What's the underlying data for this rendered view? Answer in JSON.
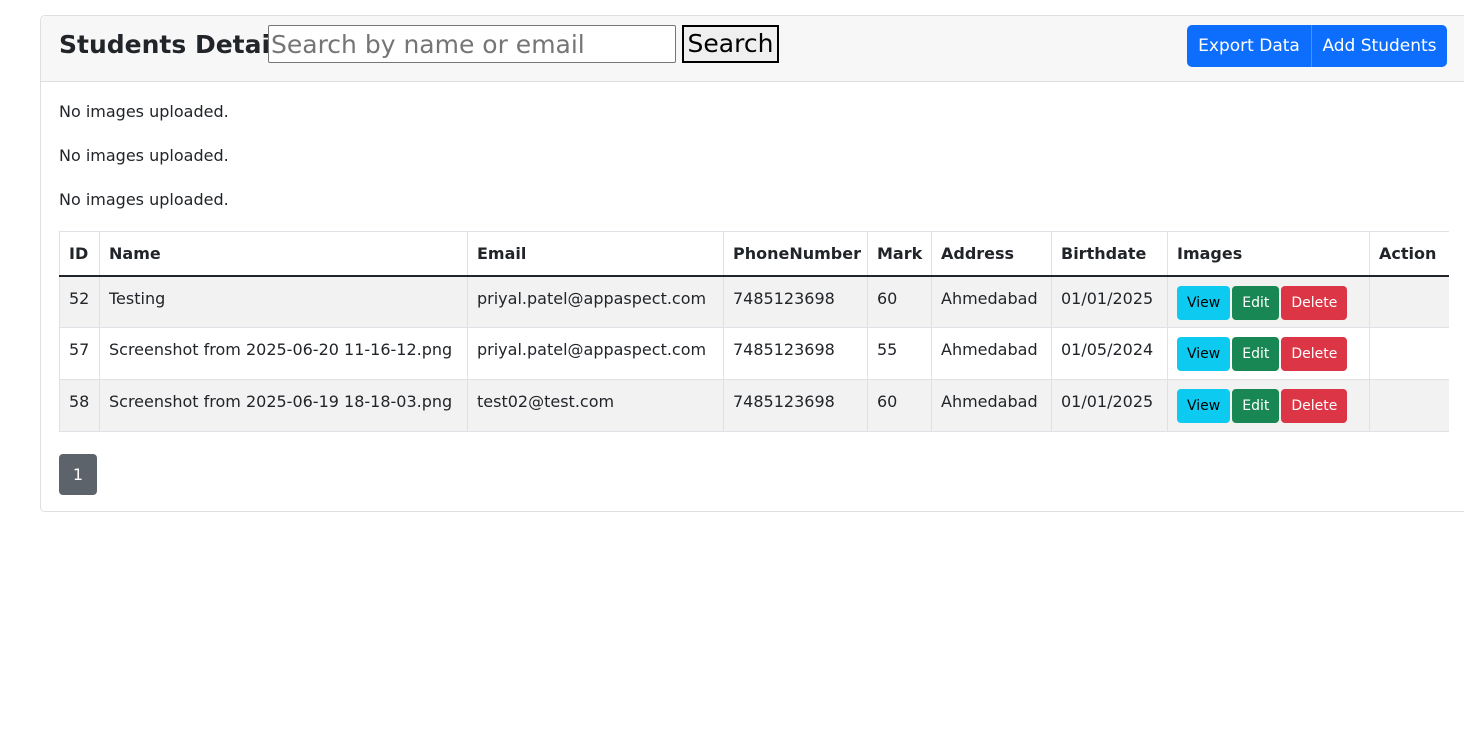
{
  "header": {
    "title": "Students Details",
    "search_placeholder": "Search by name or email",
    "search_label": "Search",
    "export_label": "Export Data",
    "add_label": "Add Students"
  },
  "messages": [
    "No images uploaded.",
    "No images uploaded.",
    "No images uploaded."
  ],
  "table": {
    "columns": [
      "ID",
      "Name",
      "Email",
      "PhoneNumber",
      "Mark",
      "Address",
      "Birthdate",
      "Images",
      "Action"
    ],
    "rows": [
      {
        "id": "52",
        "name": "Testing",
        "email": "priyal.patel@appaspect.com",
        "phone": "7485123698",
        "mark": "60",
        "address": "Ahmedabad",
        "birthdate": "01/01/2025"
      },
      {
        "id": "57",
        "name": "Screenshot from 2025-06-20 11-16-12.png",
        "email": "priyal.patel@appaspect.com",
        "phone": "7485123698",
        "mark": "55",
        "address": "Ahmedabad",
        "birthdate": "01/05/2024"
      },
      {
        "id": "58",
        "name": "Screenshot from 2025-06-19 18-18-03.png",
        "email": "test02@test.com",
        "phone": "7485123698",
        "mark": "60",
        "address": "Ahmedabad",
        "birthdate": "01/01/2025"
      }
    ],
    "actions": {
      "view": "View",
      "edit": "Edit",
      "delete": "Delete"
    }
  },
  "pagination": {
    "current": "1"
  },
  "colors": {
    "primary": "#0d6efd",
    "info": "#0dcaf0",
    "success": "#198754",
    "danger": "#dc3545",
    "secondary": "#5c636a"
  }
}
